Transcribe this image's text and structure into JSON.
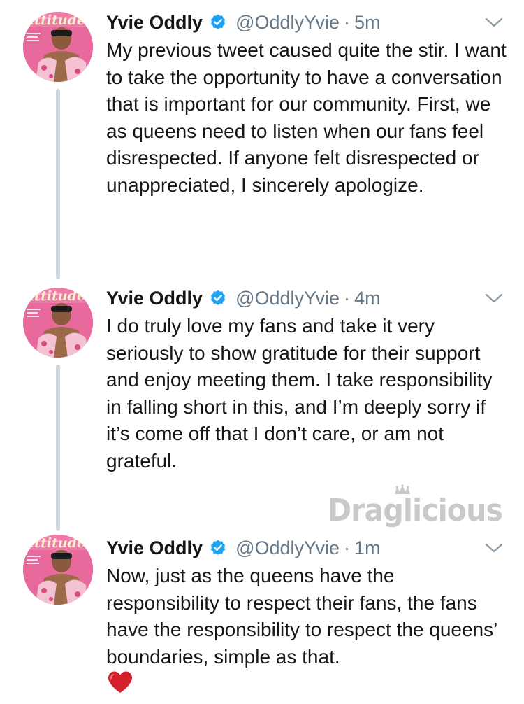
{
  "tweets": [
    {
      "display_name": "Yvie Oddly",
      "handle": "@OddlyYvie",
      "separator": "·",
      "time": "5m",
      "text": "My previous tweet caused quite the stir. I want to take the opportunity to have a conversation that is important for our community. First, we as queens need to listen when our fans feel disrespected. If anyone felt disrespected or unappreciated, I sincerely apologize."
    },
    {
      "display_name": "Yvie Oddly",
      "handle": "@OddlyYvie",
      "separator": "·",
      "time": "4m",
      "text": "I do truly love my fans and take it very seriously to show gratitude for their support and enjoy meeting them. I take responsibility in falling short in this, and I’m deeply sorry if it’s come off that I don’t care, or am not grateful."
    },
    {
      "display_name": "Yvie Oddly",
      "handle": "@OddlyYvie",
      "separator": "·",
      "time": "1m",
      "text": "Now, just as the queens have the responsibility to respect their fans, the fans have the responsibility to respect the queens’ boundaries, simple as that."
    }
  ],
  "avatar_magazine_title": "attitude",
  "watermark_text": "Draglicious",
  "icons": {
    "verified": "verified-badge-icon",
    "caret": "chevron-down-icon",
    "heart": "red-heart-emoji",
    "watermark_crown": "crown-icon"
  },
  "colors": {
    "text": "#14171a",
    "secondary": "#657786",
    "verified_blue": "#1da1f2",
    "thread_line": "#ccd6dd",
    "heart": "#d4202a",
    "watermark": "#c9c9c9"
  }
}
